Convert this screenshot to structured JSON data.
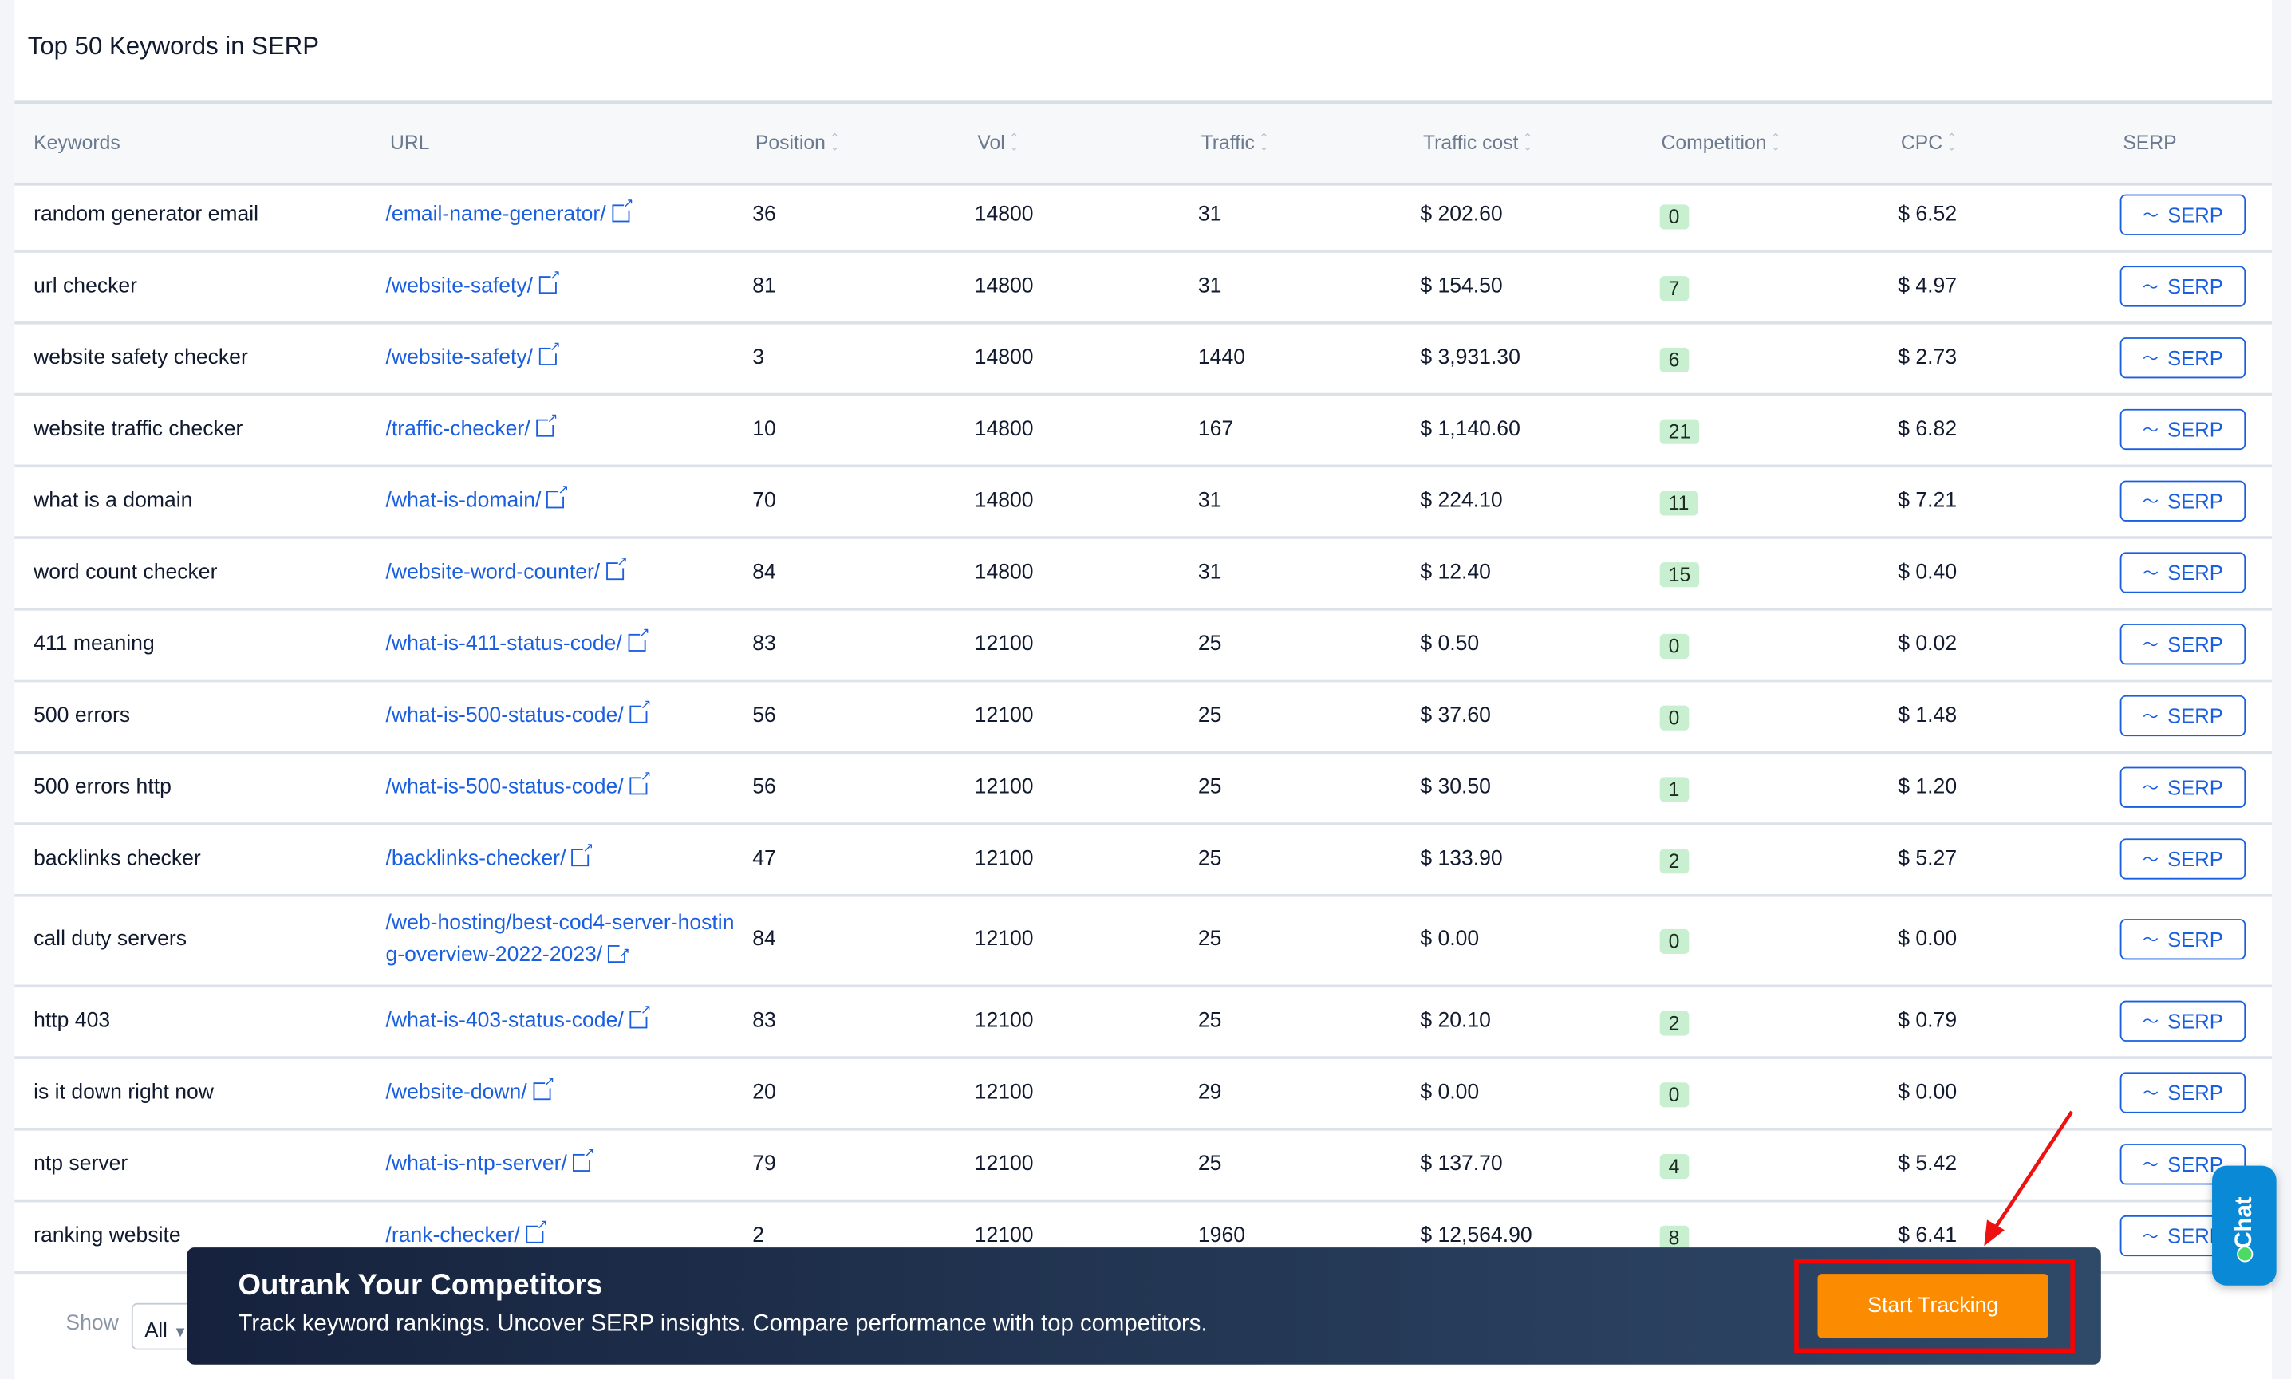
{
  "title": "Top 50 Keywords in SERP",
  "columns": [
    "Keywords",
    "URL",
    "Position",
    "Vol",
    "Traffic",
    "Traffic cost",
    "Competition",
    "CPC",
    "SERP"
  ],
  "rows": [
    {
      "keyword": "random generator email",
      "url": "/email-name-generator/",
      "position": "36",
      "vol": "14800",
      "traffic": "31",
      "cost": "$ 202.60",
      "competition": "0",
      "cpc": "$ 6.52"
    },
    {
      "keyword": "url checker",
      "url": "/website-safety/",
      "position": "81",
      "vol": "14800",
      "traffic": "31",
      "cost": "$ 154.50",
      "competition": "7",
      "cpc": "$ 4.97"
    },
    {
      "keyword": "website safety checker",
      "url": "/website-safety/",
      "position": "3",
      "vol": "14800",
      "traffic": "1440",
      "cost": "$ 3,931.30",
      "competition": "6",
      "cpc": "$ 2.73"
    },
    {
      "keyword": "website traffic checker",
      "url": "/traffic-checker/",
      "position": "10",
      "vol": "14800",
      "traffic": "167",
      "cost": "$ 1,140.60",
      "competition": "21",
      "cpc": "$ 6.82"
    },
    {
      "keyword": "what is a domain",
      "url": "/what-is-domain/",
      "position": "70",
      "vol": "14800",
      "traffic": "31",
      "cost": "$ 224.10",
      "competition": "11",
      "cpc": "$ 7.21"
    },
    {
      "keyword": "word count checker",
      "url": "/website-word-counter/",
      "position": "84",
      "vol": "14800",
      "traffic": "31",
      "cost": "$ 12.40",
      "competition": "15",
      "cpc": "$ 0.40"
    },
    {
      "keyword": "411 meaning",
      "url": "/what-is-411-status-code/",
      "position": "83",
      "vol": "12100",
      "traffic": "25",
      "cost": "$ 0.50",
      "competition": "0",
      "cpc": "$ 0.02"
    },
    {
      "keyword": "500 errors",
      "url": "/what-is-500-status-code/",
      "position": "56",
      "vol": "12100",
      "traffic": "25",
      "cost": "$ 37.60",
      "competition": "0",
      "cpc": "$ 1.48"
    },
    {
      "keyword": "500 errors http",
      "url": "/what-is-500-status-code/",
      "position": "56",
      "vol": "12100",
      "traffic": "25",
      "cost": "$ 30.50",
      "competition": "1",
      "cpc": "$ 1.20"
    },
    {
      "keyword": "backlinks checker",
      "url": "/backlinks-checker/",
      "position": "47",
      "vol": "12100",
      "traffic": "25",
      "cost": "$ 133.90",
      "competition": "2",
      "cpc": "$ 5.27"
    },
    {
      "keyword": "call duty servers",
      "url": "/web-hosting/best-cod4-server-hosting-overview-2022-2023/",
      "position": "84",
      "vol": "12100",
      "traffic": "25",
      "cost": "$ 0.00",
      "competition": "0",
      "cpc": "$ 0.00"
    },
    {
      "keyword": "http 403",
      "url": "/what-is-403-status-code/",
      "position": "83",
      "vol": "12100",
      "traffic": "25",
      "cost": "$ 20.10",
      "competition": "2",
      "cpc": "$ 0.79"
    },
    {
      "keyword": "is it down right now",
      "url": "/website-down/",
      "position": "20",
      "vol": "12100",
      "traffic": "29",
      "cost": "$ 0.00",
      "competition": "0",
      "cpc": "$ 0.00"
    },
    {
      "keyword": "ntp server",
      "url": "/what-is-ntp-server/",
      "position": "79",
      "vol": "12100",
      "traffic": "25",
      "cost": "$ 137.70",
      "competition": "4",
      "cpc": "$ 5.42"
    },
    {
      "keyword": "ranking website",
      "url": "/rank-checker/",
      "position": "2",
      "vol": "12100",
      "traffic": "1960",
      "cost": "$ 12,564.90",
      "competition": "8",
      "cpc": "$ 6.41"
    }
  ],
  "serp_button_label": "SERP",
  "pagination": {
    "show_label": "Show",
    "selected": "All"
  },
  "banner": {
    "title": "Outrank Your Competitors",
    "subtitle": "Track keyword rankings. Uncover SERP insights. Compare performance with top competitors.",
    "cta": "Start Tracking"
  },
  "chat_label": "Chat",
  "colors": {
    "accent": "#1a5fe0",
    "cta": "#fb8b00",
    "badge": "#c8efd0",
    "highlight": "#ff0000",
    "chat": "#0a8ad6"
  }
}
